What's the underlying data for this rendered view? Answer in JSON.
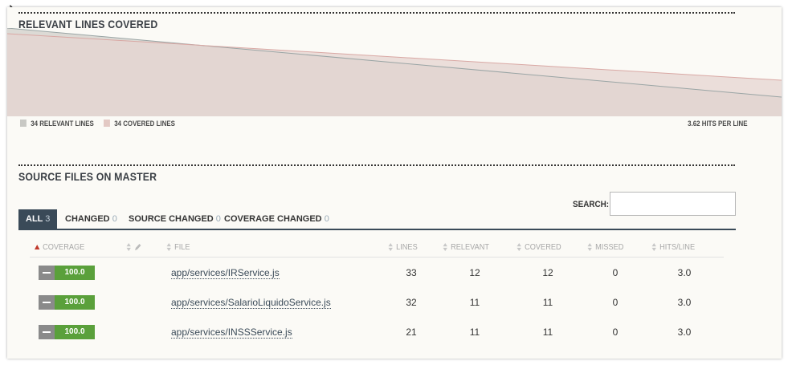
{
  "coverage_chart": {
    "title": "RELEVANT LINES COVERED",
    "legend": [
      {
        "label": "34 RELEVANT LINES",
        "color": "#c8c8c4"
      },
      {
        "label": "34 COVERED LINES",
        "color": "#e3c9c4"
      }
    ],
    "hits_per_line": "3.62 HITS PER LINE",
    "colors": {
      "relevant_fill": "#dcdad5",
      "covered_fill": "#e6d4d0",
      "relevant_line": "#9aa5a5",
      "covered_line": "#d9a8a4"
    }
  },
  "source_files": {
    "title": "SOURCE FILES ON MASTER",
    "search_label": "SEARCH:",
    "search_value": "",
    "tabs": [
      {
        "label": "ALL",
        "count": "3",
        "active": true
      },
      {
        "label": "CHANGED",
        "count": "0"
      },
      {
        "label": "SOURCE CHANGED",
        "count": "0"
      },
      {
        "label": "COVERAGE CHANGED",
        "count": "0"
      }
    ],
    "columns": [
      "COVERAGE",
      "FILE",
      "LINES",
      "RELEVANT",
      "COVERED",
      "MISSED",
      "HITS/LINE"
    ],
    "rows": [
      {
        "coverage": "100.0",
        "file": "app/services/IRService.js",
        "lines": "33",
        "relevant": "12",
        "covered": "12",
        "missed": "0",
        "hits": "3.0"
      },
      {
        "coverage": "100.0",
        "file": "app/services/SalarioLiquidoService.js",
        "lines": "32",
        "relevant": "11",
        "covered": "11",
        "missed": "0",
        "hits": "3.0"
      },
      {
        "coverage": "100.0",
        "file": "app/services/INSSService.js",
        "lines": "21",
        "relevant": "11",
        "covered": "11",
        "missed": "0",
        "hits": "3.0"
      }
    ],
    "colors": {
      "badge_green": "#5aa03b",
      "badge_gray": "#8a8a8a",
      "tab_active": "#3a4a58",
      "sort_active": "#c0392b"
    }
  }
}
